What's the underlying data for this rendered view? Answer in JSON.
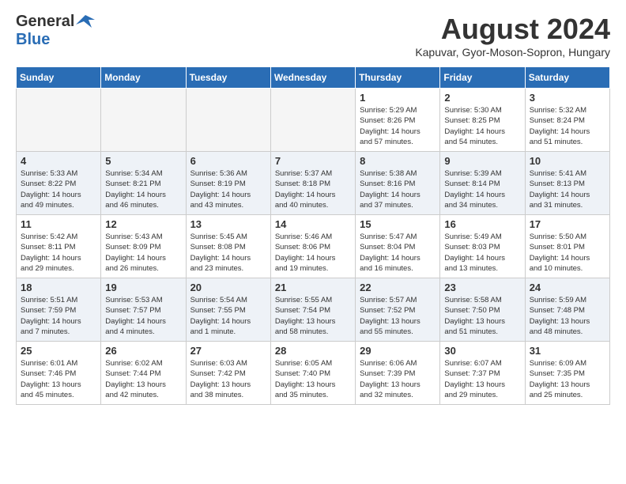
{
  "header": {
    "logo_general": "General",
    "logo_blue": "Blue",
    "title": "August 2024",
    "subtitle": "Kapuvar, Gyor-Moson-Sopron, Hungary"
  },
  "weekdays": [
    "Sunday",
    "Monday",
    "Tuesday",
    "Wednesday",
    "Thursday",
    "Friday",
    "Saturday"
  ],
  "weeks": [
    {
      "days": [
        {
          "num": "",
          "content": ""
        },
        {
          "num": "",
          "content": ""
        },
        {
          "num": "",
          "content": ""
        },
        {
          "num": "",
          "content": ""
        },
        {
          "num": "1",
          "content": "Sunrise: 5:29 AM\nSunset: 8:26 PM\nDaylight: 14 hours\nand 57 minutes."
        },
        {
          "num": "2",
          "content": "Sunrise: 5:30 AM\nSunset: 8:25 PM\nDaylight: 14 hours\nand 54 minutes."
        },
        {
          "num": "3",
          "content": "Sunrise: 5:32 AM\nSunset: 8:24 PM\nDaylight: 14 hours\nand 51 minutes."
        }
      ]
    },
    {
      "days": [
        {
          "num": "4",
          "content": "Sunrise: 5:33 AM\nSunset: 8:22 PM\nDaylight: 14 hours\nand 49 minutes."
        },
        {
          "num": "5",
          "content": "Sunrise: 5:34 AM\nSunset: 8:21 PM\nDaylight: 14 hours\nand 46 minutes."
        },
        {
          "num": "6",
          "content": "Sunrise: 5:36 AM\nSunset: 8:19 PM\nDaylight: 14 hours\nand 43 minutes."
        },
        {
          "num": "7",
          "content": "Sunrise: 5:37 AM\nSunset: 8:18 PM\nDaylight: 14 hours\nand 40 minutes."
        },
        {
          "num": "8",
          "content": "Sunrise: 5:38 AM\nSunset: 8:16 PM\nDaylight: 14 hours\nand 37 minutes."
        },
        {
          "num": "9",
          "content": "Sunrise: 5:39 AM\nSunset: 8:14 PM\nDaylight: 14 hours\nand 34 minutes."
        },
        {
          "num": "10",
          "content": "Sunrise: 5:41 AM\nSunset: 8:13 PM\nDaylight: 14 hours\nand 31 minutes."
        }
      ]
    },
    {
      "days": [
        {
          "num": "11",
          "content": "Sunrise: 5:42 AM\nSunset: 8:11 PM\nDaylight: 14 hours\nand 29 minutes."
        },
        {
          "num": "12",
          "content": "Sunrise: 5:43 AM\nSunset: 8:09 PM\nDaylight: 14 hours\nand 26 minutes."
        },
        {
          "num": "13",
          "content": "Sunrise: 5:45 AM\nSunset: 8:08 PM\nDaylight: 14 hours\nand 23 minutes."
        },
        {
          "num": "14",
          "content": "Sunrise: 5:46 AM\nSunset: 8:06 PM\nDaylight: 14 hours\nand 19 minutes."
        },
        {
          "num": "15",
          "content": "Sunrise: 5:47 AM\nSunset: 8:04 PM\nDaylight: 14 hours\nand 16 minutes."
        },
        {
          "num": "16",
          "content": "Sunrise: 5:49 AM\nSunset: 8:03 PM\nDaylight: 14 hours\nand 13 minutes."
        },
        {
          "num": "17",
          "content": "Sunrise: 5:50 AM\nSunset: 8:01 PM\nDaylight: 14 hours\nand 10 minutes."
        }
      ]
    },
    {
      "days": [
        {
          "num": "18",
          "content": "Sunrise: 5:51 AM\nSunset: 7:59 PM\nDaylight: 14 hours\nand 7 minutes."
        },
        {
          "num": "19",
          "content": "Sunrise: 5:53 AM\nSunset: 7:57 PM\nDaylight: 14 hours\nand 4 minutes."
        },
        {
          "num": "20",
          "content": "Sunrise: 5:54 AM\nSunset: 7:55 PM\nDaylight: 14 hours\nand 1 minute."
        },
        {
          "num": "21",
          "content": "Sunrise: 5:55 AM\nSunset: 7:54 PM\nDaylight: 13 hours\nand 58 minutes."
        },
        {
          "num": "22",
          "content": "Sunrise: 5:57 AM\nSunset: 7:52 PM\nDaylight: 13 hours\nand 55 minutes."
        },
        {
          "num": "23",
          "content": "Sunrise: 5:58 AM\nSunset: 7:50 PM\nDaylight: 13 hours\nand 51 minutes."
        },
        {
          "num": "24",
          "content": "Sunrise: 5:59 AM\nSunset: 7:48 PM\nDaylight: 13 hours\nand 48 minutes."
        }
      ]
    },
    {
      "days": [
        {
          "num": "25",
          "content": "Sunrise: 6:01 AM\nSunset: 7:46 PM\nDaylight: 13 hours\nand 45 minutes."
        },
        {
          "num": "26",
          "content": "Sunrise: 6:02 AM\nSunset: 7:44 PM\nDaylight: 13 hours\nand 42 minutes."
        },
        {
          "num": "27",
          "content": "Sunrise: 6:03 AM\nSunset: 7:42 PM\nDaylight: 13 hours\nand 38 minutes."
        },
        {
          "num": "28",
          "content": "Sunrise: 6:05 AM\nSunset: 7:40 PM\nDaylight: 13 hours\nand 35 minutes."
        },
        {
          "num": "29",
          "content": "Sunrise: 6:06 AM\nSunset: 7:39 PM\nDaylight: 13 hours\nand 32 minutes."
        },
        {
          "num": "30",
          "content": "Sunrise: 6:07 AM\nSunset: 7:37 PM\nDaylight: 13 hours\nand 29 minutes."
        },
        {
          "num": "31",
          "content": "Sunrise: 6:09 AM\nSunset: 7:35 PM\nDaylight: 13 hours\nand 25 minutes."
        }
      ]
    }
  ]
}
